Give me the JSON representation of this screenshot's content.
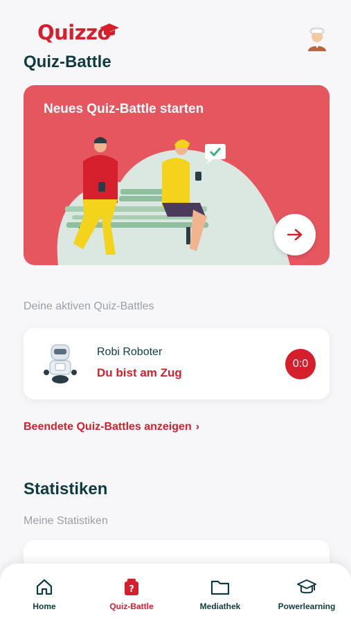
{
  "app": {
    "logo_text": "Quizzo"
  },
  "page": {
    "title": "Quiz-Battle"
  },
  "hero": {
    "title": "Neues Quiz-Battle starten",
    "action_icon": "arrow-right-icon"
  },
  "active_battles": {
    "label": "Deine aktiven Quiz-Battles",
    "items": [
      {
        "opponent": "Robi Roboter",
        "status": "Du bist am Zug",
        "score": "0:0"
      }
    ]
  },
  "finished_link": {
    "label": "Beendete Quiz-Battles anzeigen"
  },
  "stats": {
    "title": "Statistiken",
    "subtitle": "Meine Statistiken"
  },
  "tabs": [
    {
      "label": "Home",
      "icon": "home-icon",
      "active": false
    },
    {
      "label": "Quiz-Battle",
      "icon": "quiz-battle-icon",
      "active": true
    },
    {
      "label": "Mediathek",
      "icon": "folder-icon",
      "active": false
    },
    {
      "label": "Powerlearning",
      "icon": "graduation-cap-icon",
      "active": false
    }
  ],
  "colors": {
    "brand_red": "#d61f2c",
    "hero_bg": "#e5565f",
    "text_dark": "#0d3b3e",
    "muted": "#9aa0a6"
  }
}
